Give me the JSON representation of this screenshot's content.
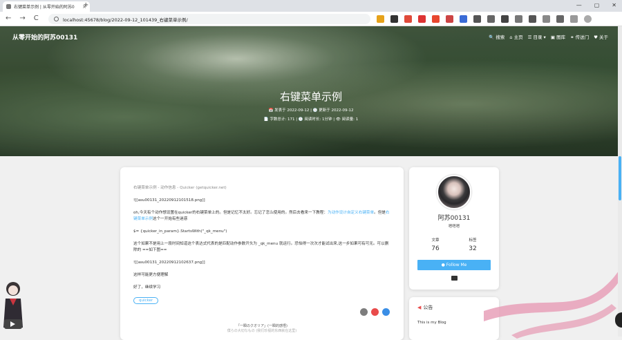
{
  "browser": {
    "tab_title": "右键菜单示例 | 从零开始的阿苏0",
    "tab_close": "×",
    "new_tab": "+",
    "url": "localhost:45678/blog/2022-09-12_101439_右键菜单示例/",
    "back": "←",
    "forward": "→",
    "reload": "C",
    "window_controls": [
      "—",
      "▢",
      "✕"
    ]
  },
  "colors": {
    "accent": "#49b1f5",
    "ribbon": "#e8a0b8"
  },
  "site": {
    "brand": "从零开始的阿苏00131",
    "menu": [
      {
        "icon": "search-icon",
        "glyph": "🔍",
        "label": "搜索"
      },
      {
        "icon": "home-icon",
        "glyph": "⌂",
        "label": "主页"
      },
      {
        "icon": "list-icon",
        "glyph": "☰",
        "label": "目录 ▾"
      },
      {
        "icon": "image-icon",
        "glyph": "▣",
        "label": "图库"
      },
      {
        "icon": "link-icon",
        "glyph": "⚭",
        "label": "传送门"
      },
      {
        "icon": "heart-icon",
        "glyph": "♥",
        "label": "关于"
      }
    ]
  },
  "hero": {
    "title": "右键菜单示例",
    "meta_line1": "📅 发表于 2022-09-12 | 🕒 更新于 2022-09-12",
    "meta_line2": "📄 字数总计: 171 | 🕓 阅读时长: 1分钟 | 👁 阅读量: 1"
  },
  "post": {
    "crumb": "右键菜单示例 - 动作信息 - Quicker (getquicker.net)",
    "p1": "![[asu00131_20220912101518.png]]",
    "p2a": "oh,今天有个动作想设置在quicker的右键菜单上的。但是记忆不太好。忘记了怎么使用的。然后去看来一下教程：",
    "p2link": "为动作设计自定义右键菜单",
    "p2b": "。但是",
    "p2link2": "右键菜单示例",
    "p2c": "这个一开始有些迷惑",
    "p3": "$= {quicker_in_param}.StartsWith(\"_qk_menu\")",
    "p4": "这个如果不是用上一段时间知道这个表达式代表的是匹配动作参数开头为 _qk_menu 就运行。恐怕得一次次才能试出来,这一步如果可有可无。可以删除的 ==如下图==",
    "p5": "![[asu00131_20220912102637.png]]",
    "p6": "这样可能更方便理解",
    "p7": "好了，继续学习",
    "tag": "quicker",
    "quote1": "「一瞬のクオリア」(一瞬的感悟)",
    "quote2": "僕らの大切なもの (我们珍视的东西就在这里)"
  },
  "profile": {
    "name": "阿苏00131",
    "desc": "嗯嗯嗯",
    "articles_label": "文章",
    "articles_value": "76",
    "tags_label": "标签",
    "tags_value": "32",
    "follow": "Follow Me"
  },
  "announcement": {
    "title": "公告",
    "body": "This is my Blog"
  }
}
